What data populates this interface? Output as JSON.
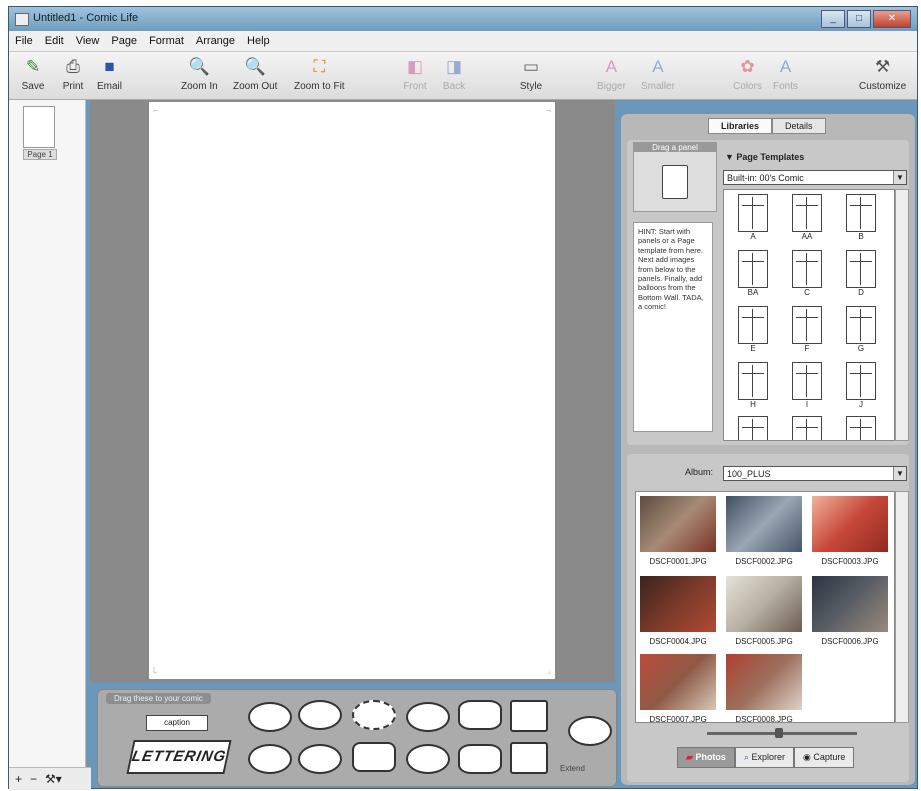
{
  "window": {
    "title": "Untitled1 - Comic Life"
  },
  "menu": [
    "File",
    "Edit",
    "View",
    "Page",
    "Format",
    "Arrange",
    "Help"
  ],
  "toolbar": {
    "save": "Save",
    "print": "Print",
    "email": "Email",
    "zoom_in": "Zoom In",
    "zoom_out": "Zoom Out",
    "zoom_fit": "Zoom to Fit",
    "front": "Front",
    "back": "Back",
    "style": "Style",
    "bigger": "Bigger",
    "smaller": "Smaller",
    "colors": "Colors",
    "fonts": "Fonts",
    "customize": "Customize"
  },
  "pages": {
    "first_label": "Page 1"
  },
  "balloon_wall": {
    "label": "Drag these to your comic",
    "caption_text": "caption",
    "lettering_text": "LETTERING",
    "extend_label": "Extend"
  },
  "sidebar": {
    "tabs": {
      "libraries": "Libraries",
      "details": "Details"
    },
    "panel_preview_label": "Drag a panel",
    "templates_title": "▼ Page Templates",
    "templates_select": "Built-in: 00's Comic",
    "hint_text": "HINT: Start with panels or a Page template from here. Next add images from below to the panels. Finally, add balloons from the Bottom Wall. TADA, a comic!",
    "templates": [
      {
        "label": "A"
      },
      {
        "label": "AA"
      },
      {
        "label": "B"
      },
      {
        "label": "BA"
      },
      {
        "label": "C"
      },
      {
        "label": "D"
      },
      {
        "label": "E"
      },
      {
        "label": "F"
      },
      {
        "label": "G"
      },
      {
        "label": "H"
      },
      {
        "label": "I"
      },
      {
        "label": "J"
      }
    ],
    "album_label": "Album:",
    "album_value": "100_PLUS",
    "photos": [
      {
        "name": "DSCF0001.JPG",
        "color": "#8a6a58"
      },
      {
        "name": "DSCF0002.JPG",
        "color": "#6d7a86"
      },
      {
        "name": "DSCF0003.JPG",
        "color": "#c8573c"
      },
      {
        "name": "DSCF0004.JPG",
        "color": "#6f3d2e"
      },
      {
        "name": "DSCF0005.JPG",
        "color": "#b6aea2"
      },
      {
        "name": "DSCF0006.JPG",
        "color": "#5a5f66"
      },
      {
        "name": "DSCF0007.JPG",
        "color": "#8e5a46"
      },
      {
        "name": "DSCF0008.JPG",
        "color": "#9c6e5c"
      }
    ],
    "source_tabs": {
      "photos": "Photos",
      "explorer": "Explorer",
      "capture": "Capture"
    }
  }
}
